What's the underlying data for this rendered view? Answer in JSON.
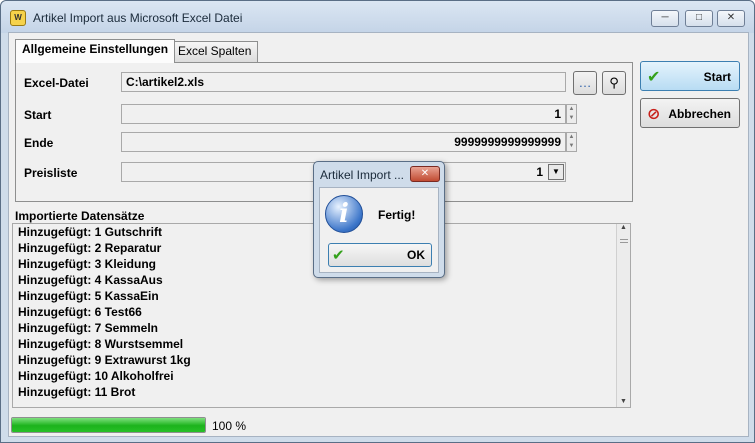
{
  "window": {
    "title": "Artikel Import aus Microsoft Excel Datei",
    "app_icon": "wo-app-icon",
    "controls": [
      "minimize",
      "maximize",
      "close"
    ]
  },
  "tabs": [
    {
      "label": "Allgemeine Einstellungen",
      "active": true
    },
    {
      "label": "Excel Spalten",
      "active": false
    }
  ],
  "settings": {
    "excel_label": "Excel-Datei",
    "excel_value": "C:\\artikel2.xls",
    "start_label": "Start",
    "start_value": "1",
    "ende_label": "Ende",
    "ende_value": "9999999999999999",
    "preisliste_label": "Preisliste",
    "preisliste_value": "1"
  },
  "buttons": {
    "start_label": "Start",
    "abbrechen_label": "Abbrechen"
  },
  "list": {
    "header": "Importierte Datensätze",
    "items": [
      "Hinzugefügt: 1 Gutschrift",
      "Hinzugefügt: 2 Reparatur",
      "Hinzugefügt: 3 Kleidung",
      "Hinzugefügt: 4 KassaAus",
      "Hinzugefügt: 5 KassaEin",
      "Hinzugefügt: 6 Test66",
      "Hinzugefügt: 7 Semmeln",
      "Hinzugefügt: 8 Wurstsemmel",
      "Hinzugefügt: 9 Extrawurst 1kg",
      "Hinzugefügt: 10 Alkoholfrei",
      "Hinzugefügt: 11 Brot"
    ]
  },
  "progress": {
    "fraction": 1.0,
    "label": "100 %",
    "color": "#1cb31c"
  },
  "dialog": {
    "title": "Artikel Import ...",
    "message": "Fertig!",
    "ok_label": "OK",
    "icon": "info-icon"
  }
}
